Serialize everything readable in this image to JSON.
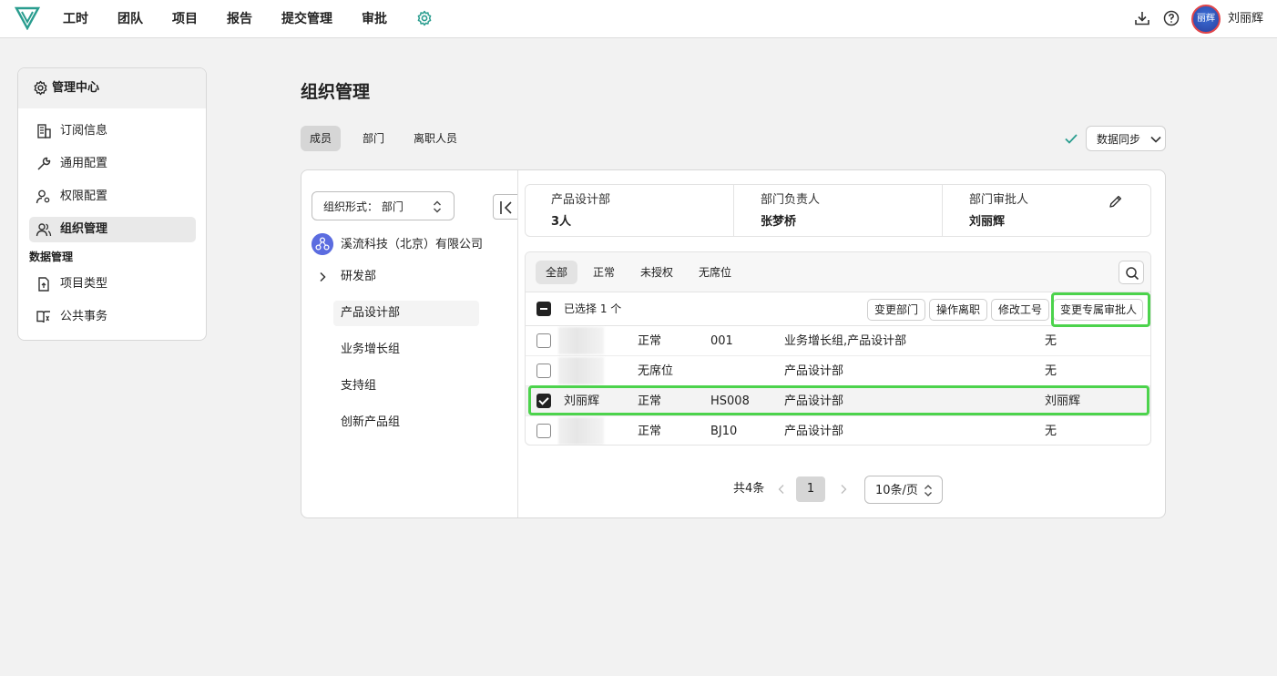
{
  "topnav": {
    "items": [
      "工时",
      "团队",
      "项目",
      "报告",
      "提交管理",
      "审批"
    ],
    "avatar_text": "丽辉",
    "user_name": "刘丽辉"
  },
  "sidebar": {
    "header": "管理中心",
    "items": [
      {
        "label": "订阅信息",
        "icon": "building-icon"
      },
      {
        "label": "通用配置",
        "icon": "wrench-icon"
      },
      {
        "label": "权限配置",
        "icon": "user-key-icon"
      },
      {
        "label": "组织管理",
        "icon": "users-icon",
        "active": true
      }
    ],
    "group_label": "数据管理",
    "group_items": [
      {
        "label": "项目类型",
        "icon": "file-upload-icon"
      },
      {
        "label": "公共事务",
        "icon": "book-icon"
      }
    ]
  },
  "page": {
    "title": "组织管理",
    "tabs": [
      "成员",
      "部门",
      "离职人员"
    ],
    "active_tab": "成员",
    "sync_button": "数据同步"
  },
  "org": {
    "select_label": "组织形式：  部门",
    "company": "溪流科技（北京）有限公司",
    "tree": [
      "研发部",
      "产品设计部",
      "业务增长组",
      "支持组",
      "创新产品组"
    ],
    "selected": "产品设计部"
  },
  "dept_info": {
    "name": "产品设计部",
    "count": "3人",
    "leader_label": "部门负责人",
    "leader": "张梦桥",
    "approver_label": "部门审批人",
    "approver": "刘丽辉"
  },
  "filters": [
    "全部",
    "正常",
    "未授权",
    "无席位"
  ],
  "active_filter": "全部",
  "selection": {
    "text": "已选择 1 个",
    "actions": [
      "变更部门",
      "操作离职",
      "修改工号",
      "变更专属审批人"
    ]
  },
  "members": [
    {
      "name": "",
      "status": "正常",
      "id": "001",
      "dept": "业务增长组,产品设计部",
      "approver": "无",
      "checked": false
    },
    {
      "name": "",
      "status": "无席位",
      "id": "",
      "dept": "产品设计部",
      "approver": "无",
      "checked": false
    },
    {
      "name": "刘丽辉",
      "status": "正常",
      "id": "HS008",
      "dept": "产品设计部",
      "approver": "刘丽辉",
      "checked": true
    },
    {
      "name": "",
      "status": "正常",
      "id": "BJ10",
      "dept": "产品设计部",
      "approver": "无",
      "checked": false
    }
  ],
  "pagination": {
    "total": "共4条",
    "current": "1",
    "page_size": "10条/页"
  },
  "colors": {
    "highlight": "#4cd34c",
    "logo": "#2a9d8f",
    "avatar_ring": "#e0464a"
  }
}
